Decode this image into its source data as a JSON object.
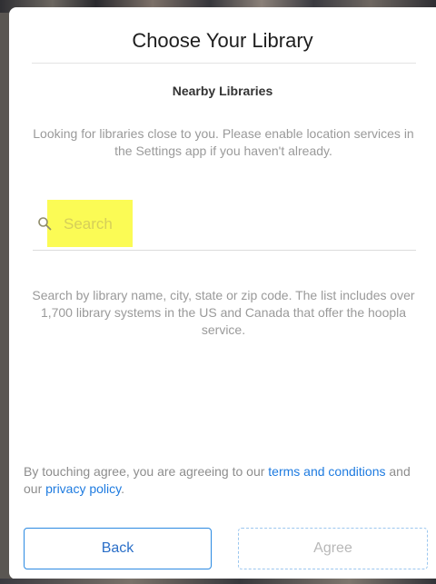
{
  "dialog": {
    "title": "Choose Your Library",
    "section_heading": "Nearby Libraries",
    "location_note": "Looking for libraries close to you. Please enable location services in the Settings app if you haven't already."
  },
  "search": {
    "placeholder": "Search",
    "value": "",
    "help_text": "Search by library name, city, state or zip code. The list includes over 1,700 library systems in the US and Canada that offer the hoopla service."
  },
  "agreement": {
    "prefix": "By touching agree, you are agreeing to our ",
    "terms_link": "terms and conditions",
    "middle": " and our ",
    "privacy_link": "privacy policy",
    "suffix": "."
  },
  "buttons": {
    "back_label": "Back",
    "agree_label": "Agree"
  },
  "colors": {
    "link": "#1e7be0",
    "highlight": "#fbfb55",
    "button_border": "#2b8ae2"
  }
}
